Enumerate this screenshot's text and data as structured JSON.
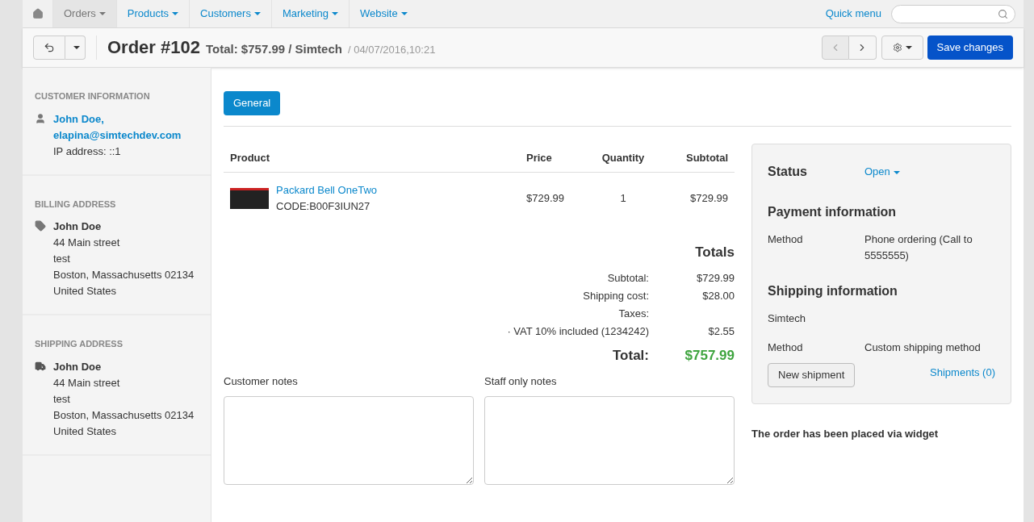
{
  "nav": {
    "items": [
      {
        "label": "Orders",
        "selected": true
      },
      {
        "label": "Products",
        "selected": false
      },
      {
        "label": "Customers",
        "selected": false
      },
      {
        "label": "Marketing",
        "selected": false
      },
      {
        "label": "Website",
        "selected": false
      }
    ],
    "quick_menu": "Quick menu"
  },
  "header": {
    "title": "Order #102",
    "summary": "Total: $757.99 / Simtech",
    "date": "/ 04/07/2016,10:21",
    "save": "Save changes"
  },
  "sidebar": [
    {
      "kind": "customer",
      "heading": "CUSTOMER INFORMATION",
      "name": "John Doe,",
      "email": "elapina@simtechdev.com",
      "lines": [
        "IP address: ::1"
      ]
    },
    {
      "kind": "billing",
      "heading": "BILLING ADDRESS",
      "name": "John Doe",
      "lines": [
        "44 Main street",
        "test",
        "Boston, Massachusetts 02134",
        "United States"
      ]
    },
    {
      "kind": "shipping",
      "heading": "SHIPPING ADDRESS",
      "name": "John Doe",
      "lines": [
        "44 Main street",
        "test",
        "Boston, Massachusetts 02134",
        "United States"
      ]
    }
  ],
  "tabs": [
    {
      "label": "General",
      "selected": true
    }
  ],
  "table": {
    "columns": [
      "Product",
      "Price",
      "Quantity",
      "Subtotal"
    ],
    "rows": [
      {
        "name": "Packard Bell OneTwo",
        "code": "CODE:B00F3IUN27",
        "price": "$729.99",
        "quantity": "1",
        "subtotal": "$729.99"
      }
    ]
  },
  "totals": {
    "heading": "Totals",
    "lines": [
      {
        "label": "Subtotal:",
        "value": "$729.99"
      },
      {
        "label": "Shipping cost:",
        "value": "$28.00"
      },
      {
        "label": "Taxes:"
      },
      {
        "label": "· VAT 10% included (1234242)",
        "value": "$2.55"
      }
    ],
    "total_label": "Total:",
    "total_value": "$757.99"
  },
  "notes": [
    {
      "label": "Customer notes"
    },
    {
      "label": "Staff only notes"
    }
  ],
  "info": {
    "status_label": "Status",
    "status": "Open",
    "payment_heading": "Payment information",
    "payment_method_label": "Method",
    "payment_method": "Phone ordering (Call to 5555555)",
    "shipping_heading": "Shipping information",
    "carrier": "Simtech",
    "shipping_method_label": "Method",
    "shipping_method": "Custom shipping method",
    "new_shipment": "New shipment",
    "shipments_link": "Shipments (0)"
  },
  "widget_note": "The order has been placed via widget"
}
